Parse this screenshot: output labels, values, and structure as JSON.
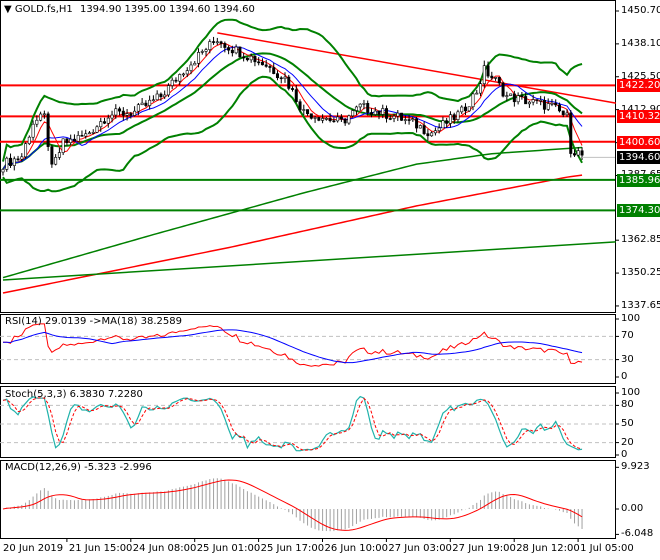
{
  "header": {
    "symbol": "GOLD.fs,H1",
    "ohlc": "1394.90 1395.00 1394.60 1394.60"
  },
  "colors": {
    "bull": "#ffffff",
    "bear": "#000000",
    "resistance": "#ff0000",
    "support": "#008000",
    "bands": "#008000",
    "ma_fast": "#ff0000",
    "ma_slow": "#0000ff",
    "stoch_main": "#20b2aa",
    "stoch_signal": "#ff0000",
    "price_tag": "#000000"
  },
  "price_axis": [
    "1450.70",
    "1438.10",
    "1425.50",
    "1412.90",
    "1400.25",
    "1387.65",
    "1362.85",
    "1350.25",
    "1337.65"
  ],
  "levels": [
    {
      "label": "1422.20",
      "price": 1422.2,
      "kind": "resistance"
    },
    {
      "label": "1410.32",
      "price": 1410.32,
      "kind": "resistance"
    },
    {
      "label": "1400.60",
      "price": 1400.6,
      "kind": "resistance"
    },
    {
      "label": "1385.96",
      "price": 1385.96,
      "kind": "support"
    },
    {
      "label": "1374.30",
      "price": 1374.3,
      "kind": "support"
    }
  ],
  "current_price": "1394.60",
  "rsi": {
    "label": "RSI(14) 29.0139  ->MA(18) 38.2589",
    "axis": [
      "100",
      "70",
      "30",
      "0"
    ]
  },
  "stoch": {
    "label": "Stoch(5,3,3) 6.3830 7.2280",
    "axis": [
      "100",
      "80",
      "50",
      "20",
      "0"
    ]
  },
  "macd": {
    "label": "MACD(12,26,9) -5.323 -2.996",
    "axis": [
      "9.923",
      "0.00",
      "-6.048"
    ]
  },
  "time_axis": [
    "20 Jun 2019",
    "21 Jun 15:00",
    "24 Jun 08:00",
    "25 Jun 01:00",
    "25 Jun 17:00",
    "26 Jun 10:00",
    "27 Jun 03:00",
    "27 Jun 19:00",
    "28 Jun 12:00",
    "1 Jul 05:00"
  ],
  "chart_data": {
    "type": "candlestick",
    "bars": 155,
    "price_keypoints": [
      [
        0,
        1392
      ],
      [
        5,
        1395
      ],
      [
        8,
        1408
      ],
      [
        11,
        1410
      ],
      [
        13,
        1390
      ],
      [
        16,
        1400
      ],
      [
        22,
        1403
      ],
      [
        28,
        1411
      ],
      [
        35,
        1412
      ],
      [
        42,
        1418
      ],
      [
        48,
        1428
      ],
      [
        53,
        1435
      ],
      [
        57,
        1440
      ],
      [
        60,
        1437
      ],
      [
        66,
        1433
      ],
      [
        70,
        1430
      ],
      [
        75,
        1425
      ],
      [
        80,
        1412
      ],
      [
        85,
        1410
      ],
      [
        90,
        1408
      ],
      [
        95,
        1414
      ],
      [
        100,
        1412
      ],
      [
        105,
        1410
      ],
      [
        110,
        1407
      ],
      [
        114,
        1404
      ],
      [
        118,
        1408
      ],
      [
        122,
        1412
      ],
      [
        126,
        1420
      ],
      [
        128,
        1428
      ],
      [
        131,
        1424
      ],
      [
        134,
        1418
      ],
      [
        140,
        1416
      ],
      [
        146,
        1414
      ],
      [
        150,
        1410
      ],
      [
        151,
        1398
      ],
      [
        155,
        1394.6
      ]
    ],
    "ma200_keypoints": [
      [
        0,
        1342.6
      ],
      [
        60,
        1360
      ],
      [
        110,
        1376
      ],
      [
        150,
        1387
      ],
      [
        155,
        1388
      ]
    ],
    "ma100_keypoints": [
      [
        0,
        1348.5
      ],
      [
        40,
        1365
      ],
      [
        80,
        1381
      ],
      [
        110,
        1392
      ],
      [
        130,
        1396
      ],
      [
        155,
        1398.5
      ]
    ],
    "trendlines": [
      {
        "kind": "resistance",
        "from": [
          57,
          1442.3
        ],
        "to": [
          163,
          1415.4
        ]
      },
      {
        "kind": "support",
        "from": [
          0,
          1347.6
        ],
        "to": [
          163,
          1362.2
        ]
      }
    ],
    "ylim": [
      1337.65,
      1450.7
    ]
  }
}
